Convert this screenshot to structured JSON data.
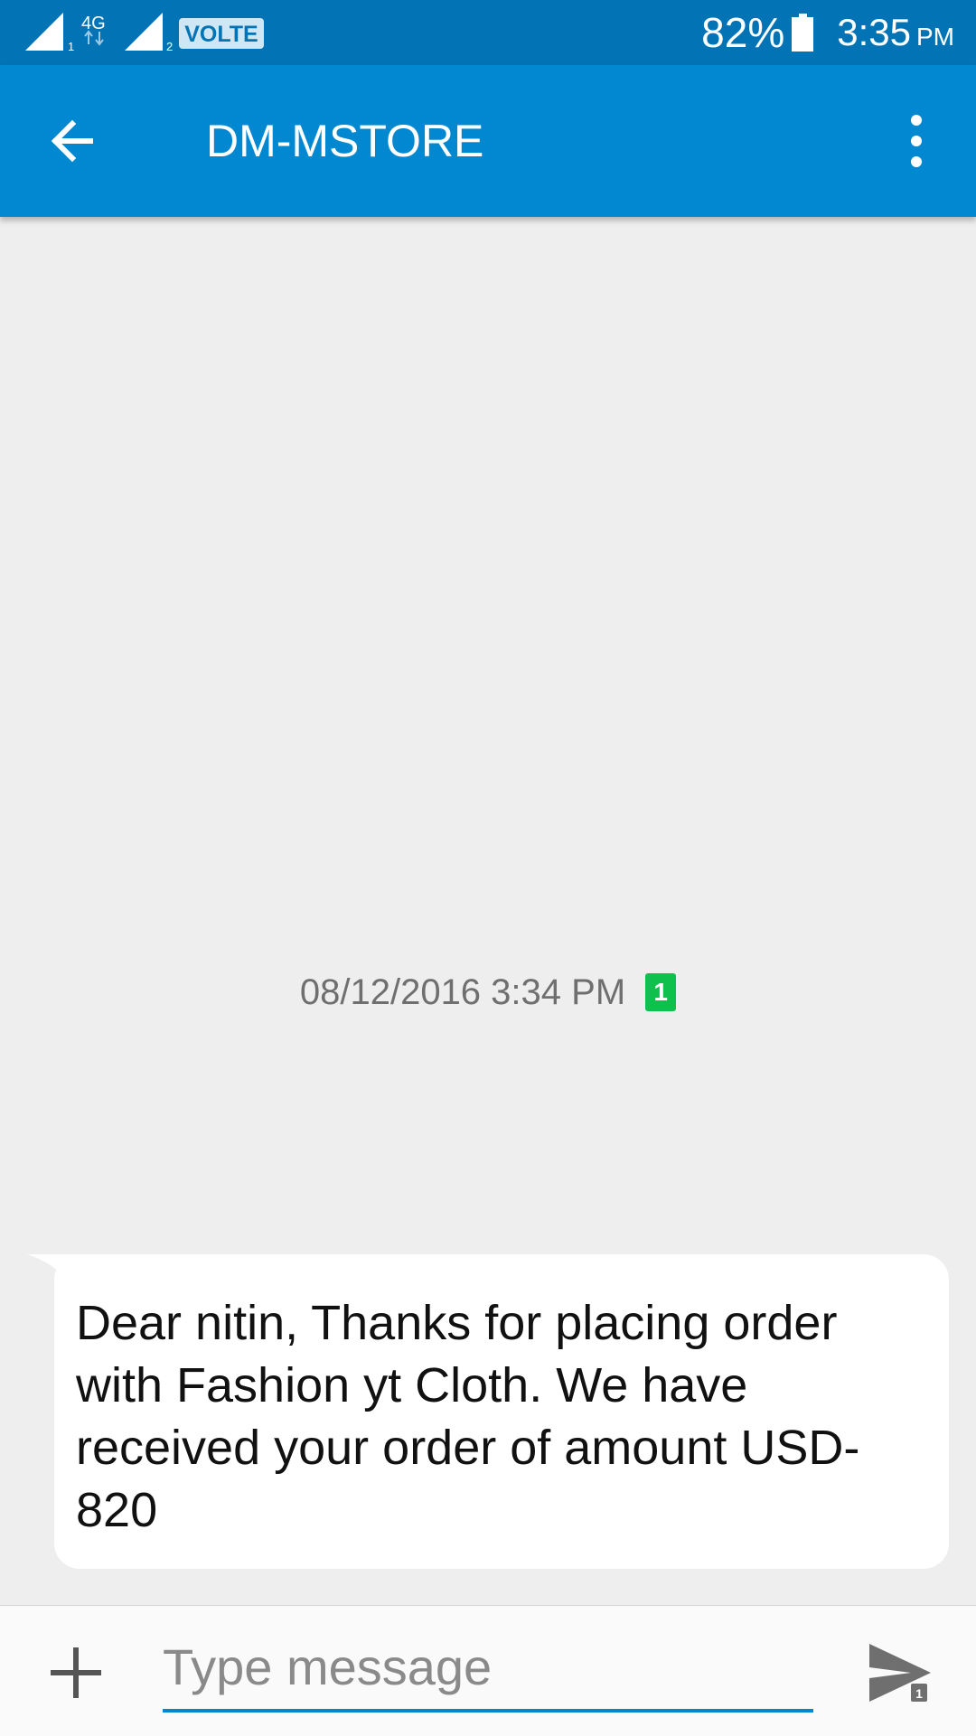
{
  "status_bar": {
    "network_type": "4G",
    "sim1_index": "1",
    "sim2_index": "2",
    "volte_label": "VOLTE",
    "battery_percent": "82%",
    "time": "3:35",
    "ampm": "PM"
  },
  "app_bar": {
    "title": "DM-MSTORE",
    "back_icon": "arrow-back-icon",
    "menu_icon": "more-vert-icon"
  },
  "conversation": {
    "timestamp": "08/12/2016 3:34 PM",
    "sim_badge": "1",
    "messages": [
      {
        "direction": "incoming",
        "text": "Dear nitin, Thanks for placing order with Fashion yt Cloth. We have received your order of amount USD-820"
      }
    ]
  },
  "compose": {
    "placeholder": "Type message",
    "value": "",
    "send_sim_index": "1",
    "attach_icon": "plus-icon",
    "send_icon": "send-icon"
  },
  "colors": {
    "status_bar": "#0274b5",
    "app_bar": "#0288d1",
    "background": "#eeeeee",
    "bubble": "#ffffff",
    "sim_badge": "#10c04c",
    "accent": "#0288d1"
  }
}
